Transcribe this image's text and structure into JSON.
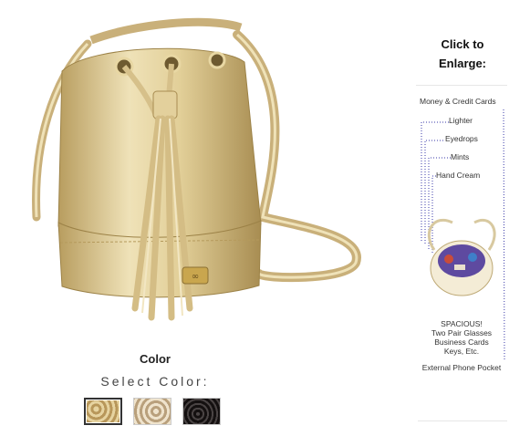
{
  "product": {
    "image_alt": "Gold leather bucket bag with drawstring tassels",
    "color_heading": "Color",
    "select_color_label": "Select Color:",
    "swatches": [
      {
        "name": "Gold",
        "color": "#c9b07a",
        "selected": true
      },
      {
        "name": "Champagne",
        "color": "#d8c6a8",
        "selected": false
      },
      {
        "name": "Black",
        "color": "#1e1a1a",
        "selected": false
      }
    ]
  },
  "sidebar": {
    "click_to_enlarge_line1": "Click to",
    "click_to_enlarge_line2": "Enlarge:",
    "labels": {
      "money": "Money & Credit Cards",
      "lighter": "Lighter",
      "eyedrops": "Eyedrops",
      "mints": "Mints",
      "hand_cream": "Hand Cream",
      "spacious_1": "SPACIOUS!",
      "spacious_2": "Two Pair Glasses",
      "spacious_3": "Business Cards",
      "spacious_4": "Keys, Etc.",
      "phone_pocket": "External Phone Pocket"
    }
  },
  "colors": {
    "gold_light": "#efe2b8",
    "gold_mid": "#d4bd85",
    "gold_dark": "#a88d52",
    "purple_lining": "#5e4aa0",
    "dot_line": "#3a3aa8"
  }
}
